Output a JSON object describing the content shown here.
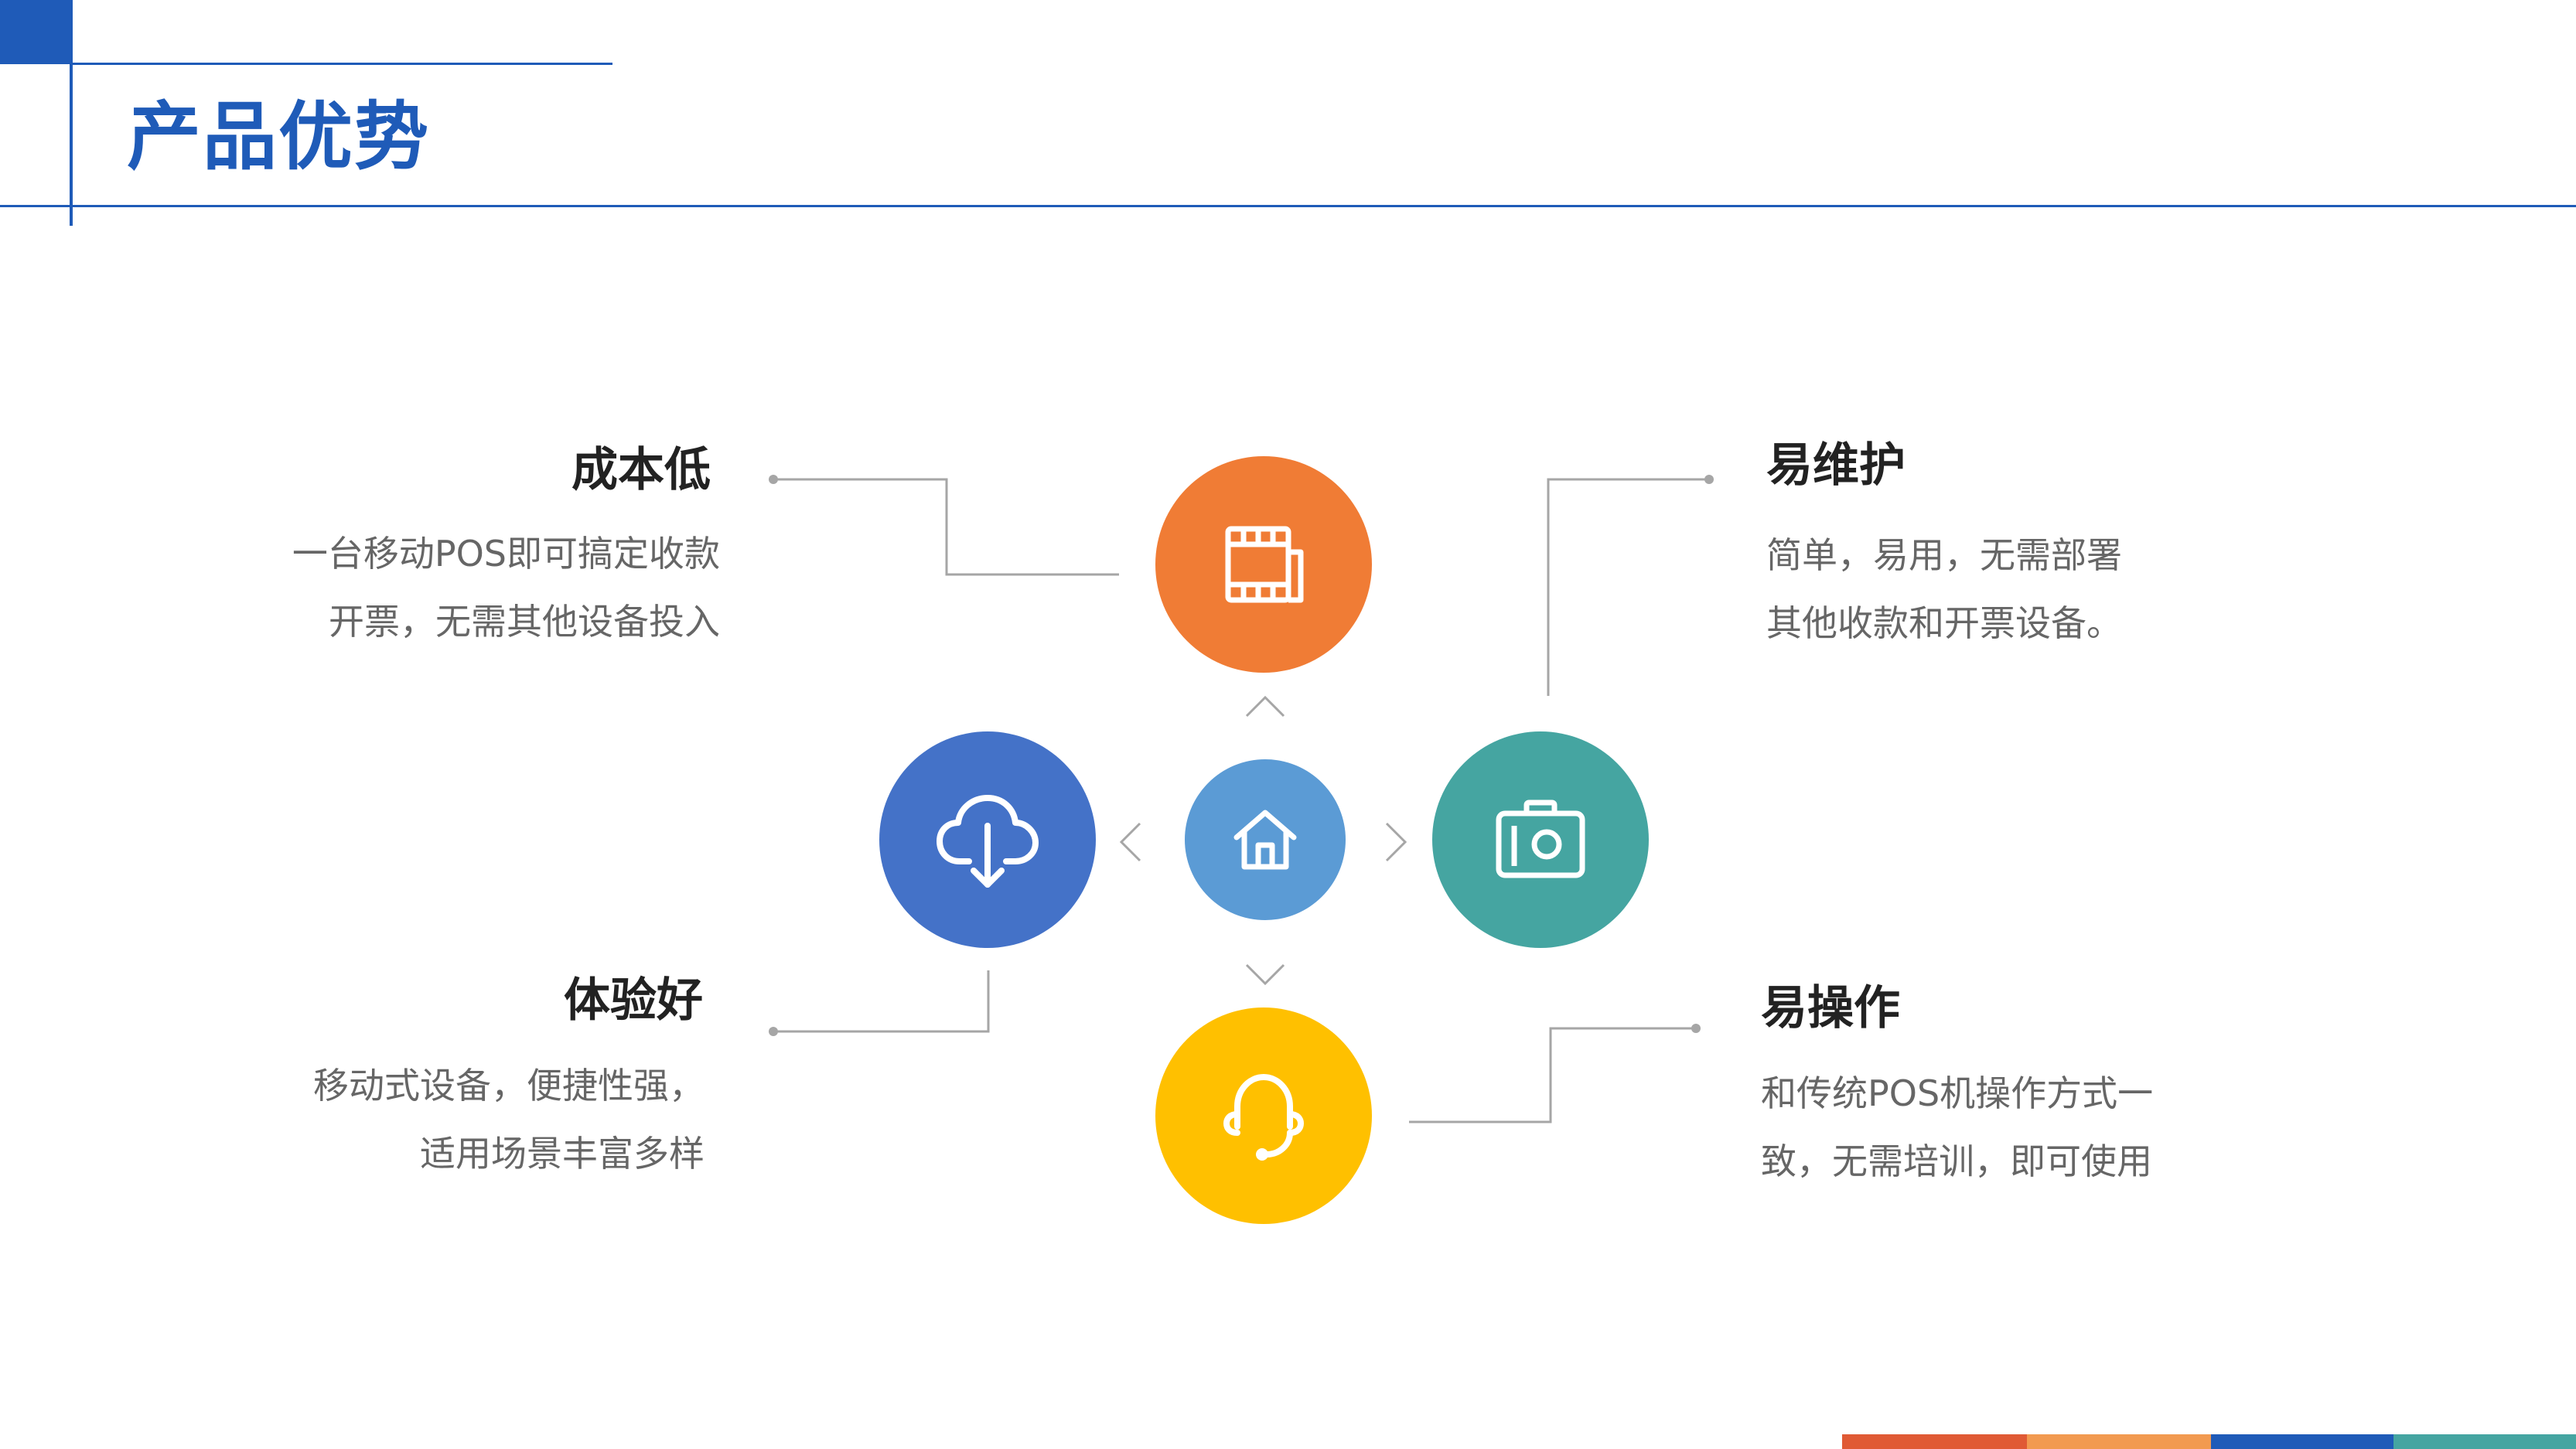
{
  "header": {
    "title": "产品优势"
  },
  "features": {
    "cost": {
      "title": "成本低",
      "line1": "一台移动POS即可搞定收款",
      "line2": "开票，无需其他设备投入"
    },
    "maintain": {
      "title": "易维护",
      "line1": "简单，易用，无需部署",
      "line2": "其他收款和开票设备。"
    },
    "experience": {
      "title": "体验好",
      "line1": "移动式设备，便捷性强，",
      "line2": "适用场景丰富多样"
    },
    "operate": {
      "title": "易操作",
      "line1": "和传统POS机操作方式一",
      "line2": "致，无需培训，即可使用"
    }
  },
  "icons": {
    "top": "film-icon",
    "left": "cloud-download-icon",
    "center": "home-icon",
    "right": "camera-icon",
    "bottom": "headset-icon"
  },
  "colors": {
    "brand_blue": "#1F5BB8",
    "orange": "#F07C35",
    "blue": "#4472C8",
    "light_blue": "#5B9BD5",
    "teal": "#45A5A1",
    "yellow": "#FFC000",
    "bar_red": "#E05A35",
    "bar_orange": "#F29A50",
    "bar_blue": "#1F5BB8",
    "bar_teal": "#45A5A1"
  }
}
